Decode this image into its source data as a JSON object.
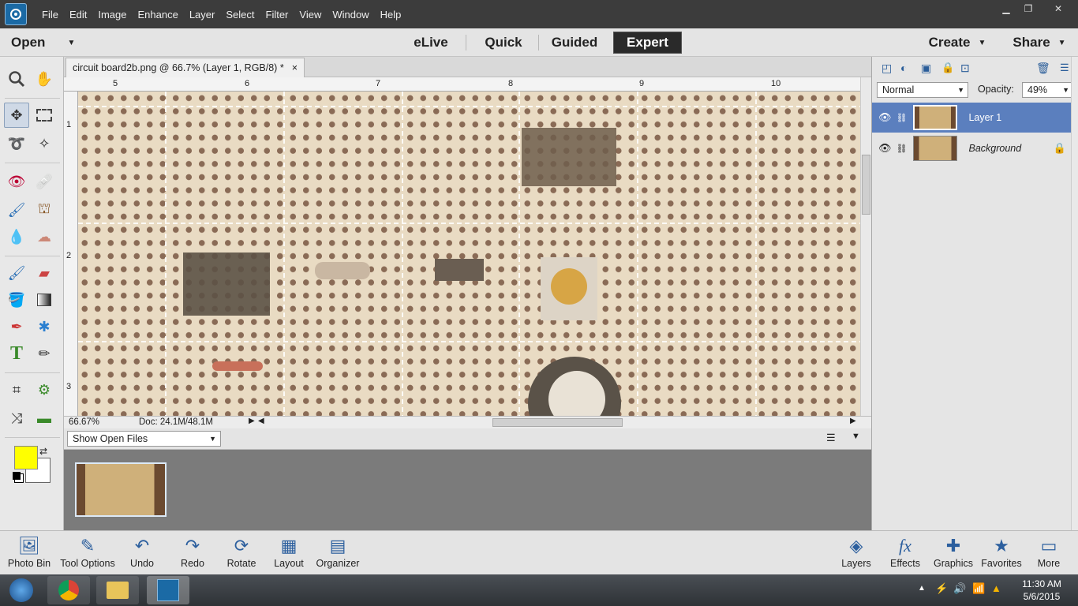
{
  "menubar": {
    "items": [
      "File",
      "Edit",
      "Image",
      "Enhance",
      "Layer",
      "Select",
      "Filter",
      "View",
      "Window",
      "Help"
    ]
  },
  "modebar": {
    "open": "Open",
    "modes": [
      "eLive",
      "Quick",
      "Guided",
      "Expert"
    ],
    "create": "Create",
    "share": "Share"
  },
  "document": {
    "tab_title": "circuit board2b.png @ 66.7% (Layer 1, RGB/8) *",
    "close": "×",
    "ruler_top": [
      "5",
      "6",
      "7",
      "8",
      "9",
      "10"
    ],
    "ruler_left": [
      "1",
      "2",
      "3"
    ],
    "zoom": "66.67%",
    "doc_size": "Doc: 24.1M/48.1M"
  },
  "photobin": {
    "select": "Show Open Files"
  },
  "layers": {
    "blend_mode": "Normal",
    "opacity_label": "Opacity:",
    "opacity_value": "49%",
    "items": [
      {
        "name": "Layer 1"
      },
      {
        "name": "Background"
      }
    ]
  },
  "bottombar": {
    "left": [
      "Photo Bin",
      "Tool Options",
      "Undo",
      "Redo",
      "Rotate",
      "Layout",
      "Organizer"
    ],
    "right": [
      "Layers",
      "Effects",
      "Graphics",
      "Favorites",
      "More"
    ]
  },
  "taskbar": {
    "time": "11:30 AM",
    "date": "5/6/2015"
  },
  "colors": {
    "foreground": "#ffff00",
    "background": "#ffffff",
    "accent": "#5b7fbe"
  }
}
